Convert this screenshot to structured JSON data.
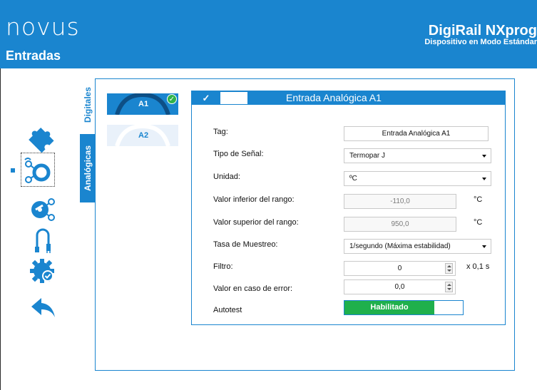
{
  "header": {
    "logo": "novus",
    "page_title": "Entradas",
    "app_title": "DigiRail NXprog",
    "app_subtitle": "Dispositivo en Modo Estándar"
  },
  "sidebar": {
    "items": [
      {
        "name": "puzzle-icon"
      },
      {
        "name": "sensor-input-icon",
        "selected": true
      },
      {
        "name": "output-icon"
      },
      {
        "name": "cable-icon"
      },
      {
        "name": "gear-check-icon"
      },
      {
        "name": "back-arrow-icon"
      }
    ]
  },
  "tabs": {
    "digitales": "Digitales",
    "analogicas": "Analógicas"
  },
  "channels": [
    {
      "label": "A1",
      "active": true,
      "check": "✓"
    },
    {
      "label": "A2",
      "active": false
    }
  ],
  "panel": {
    "check": "✓",
    "title": "Entrada Analógica A1",
    "fields": {
      "tag": {
        "label": "Tag:",
        "value": "Entrada Analógica A1"
      },
      "signal_type": {
        "label": "Tipo de Señal:",
        "value": "Termopar J"
      },
      "unit": {
        "label": "Unidad:",
        "value": "ºC"
      },
      "range_low": {
        "label": "Valor inferior del rango:",
        "value": "-110,0",
        "unit": "°C"
      },
      "range_high": {
        "label": "Valor superior del rango:",
        "value": "950,0",
        "unit": "°C"
      },
      "sample_rate": {
        "label": "Tasa de Muestreo:",
        "value": "1/segundo (Máxima estabilidad)"
      },
      "filter": {
        "label": "Filtro:",
        "value": "0",
        "unit": "x 0,1 s"
      },
      "error_value": {
        "label": "Valor en caso de error:",
        "value": "0,0"
      },
      "autotest": {
        "label": "Autotest",
        "value": "Habilitado"
      }
    }
  },
  "colors": {
    "primary": "#1a85cf",
    "success": "#1fb04c",
    "check": "#2fb24a"
  }
}
